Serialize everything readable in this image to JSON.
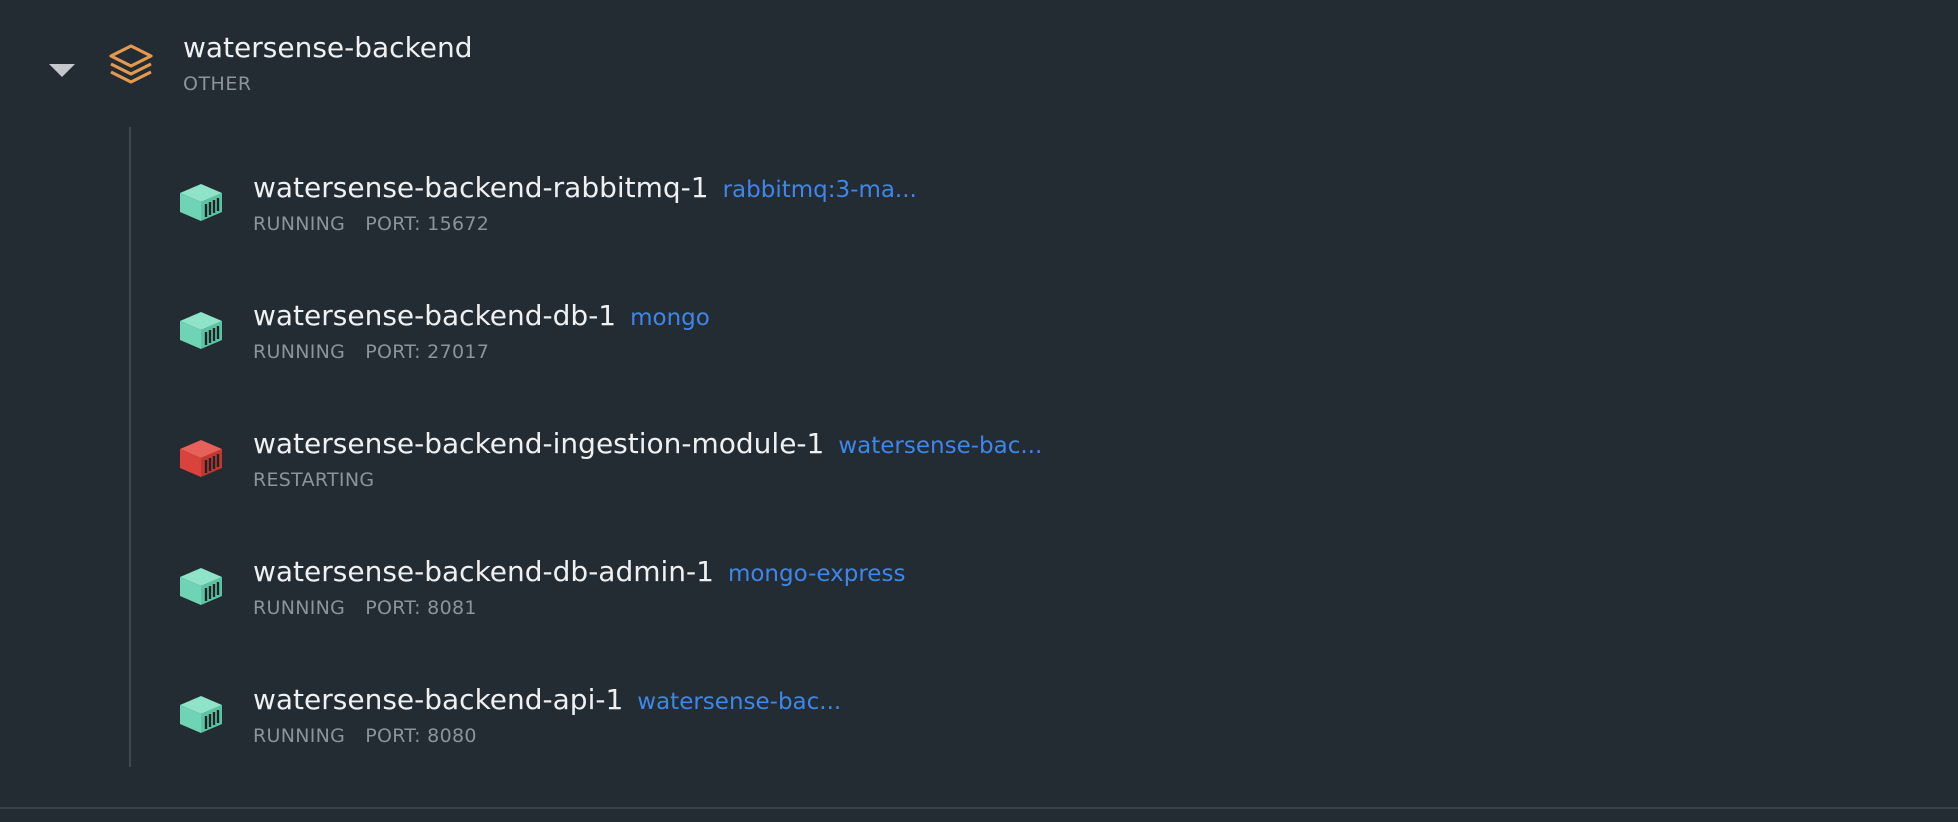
{
  "group": {
    "title": "watersense-backend",
    "type": "OTHER",
    "icon": "stack-layers-icon",
    "icon_color": "#e39a4f"
  },
  "containers": [
    {
      "name": "watersense-backend-rabbitmq-1",
      "image": "rabbitmq:3-ma...",
      "status": "RUNNING",
      "port": "PORT: 15672",
      "icon": "container-icon",
      "color": "#6fd4b4"
    },
    {
      "name": "watersense-backend-db-1",
      "image": "mongo",
      "status": "RUNNING",
      "port": "PORT: 27017",
      "icon": "container-icon",
      "color": "#6fd4b4"
    },
    {
      "name": "watersense-backend-ingestion-module-1",
      "image": "watersense-bac...",
      "status": "RESTARTING",
      "port": "",
      "icon": "container-icon",
      "color": "#d9433b"
    },
    {
      "name": "watersense-backend-db-admin-1",
      "image": "mongo-express",
      "status": "RUNNING",
      "port": "PORT: 8081",
      "icon": "container-icon",
      "color": "#6fd4b4"
    },
    {
      "name": "watersense-backend-api-1",
      "image": "watersense-bac...",
      "status": "RUNNING",
      "port": "PORT: 8080",
      "icon": "container-icon",
      "color": "#6fd4b4"
    }
  ]
}
